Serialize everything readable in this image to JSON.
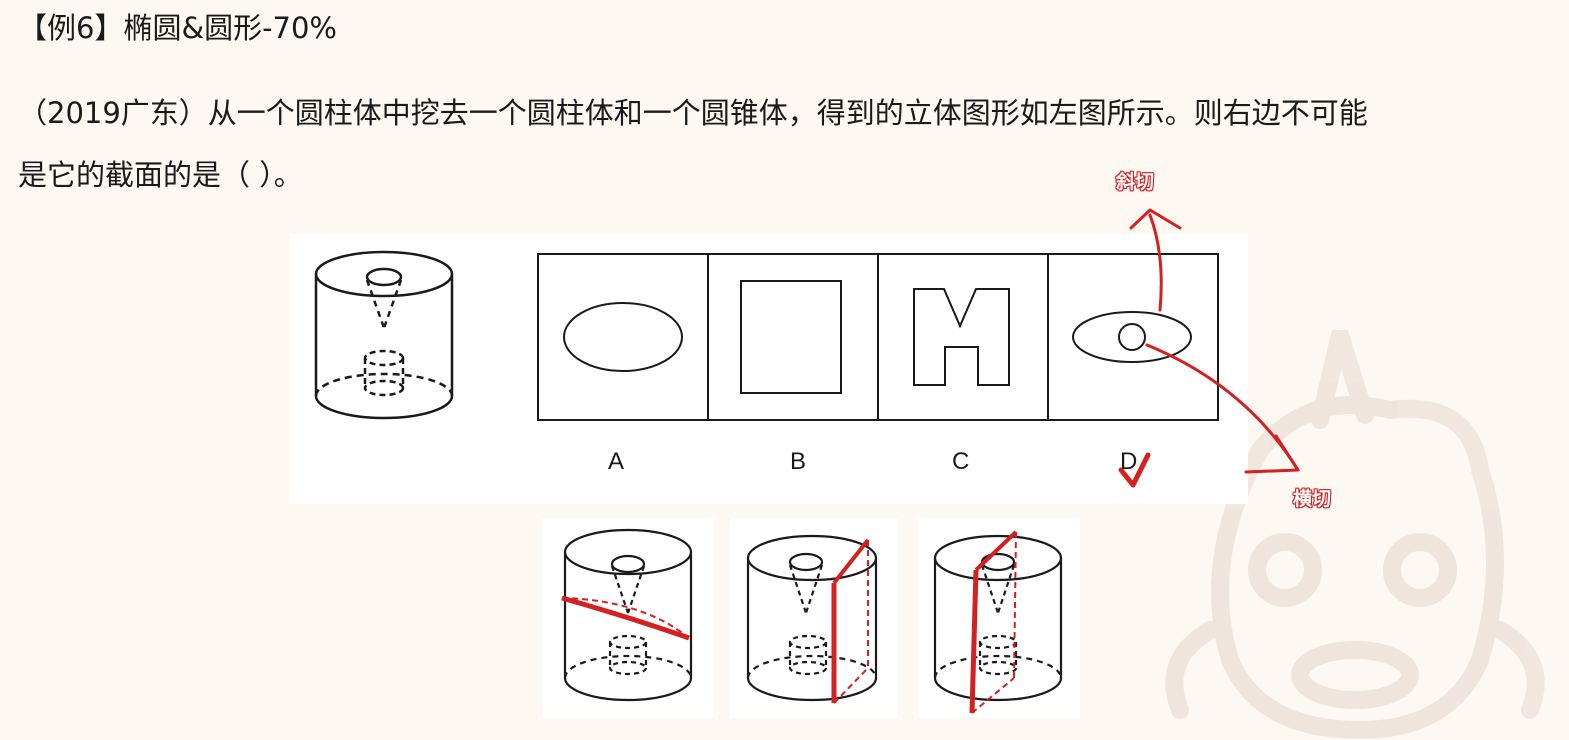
{
  "heading": "【例6】椭圆&圆形-70%",
  "question": {
    "line1": "（2019广东）从一个圆柱体中挖去一个圆柱体和一个圆锥体，得到的立体图形如左图所示。则右边不可能",
    "line2": "是它的截面的是（   ）。"
  },
  "options": [
    "A",
    "B",
    "C",
    "D"
  ],
  "annotations": {
    "oblique_cut": "斜切",
    "horizontal_cut": "横切",
    "correct_answer": "D"
  },
  "colors": {
    "background": "#fdf8f2",
    "annotation_red": "#d42020",
    "line": "#1a1a1a"
  },
  "icons": {
    "checkmark": "check-icon",
    "watermark": "unicorn-mascot-icon"
  }
}
